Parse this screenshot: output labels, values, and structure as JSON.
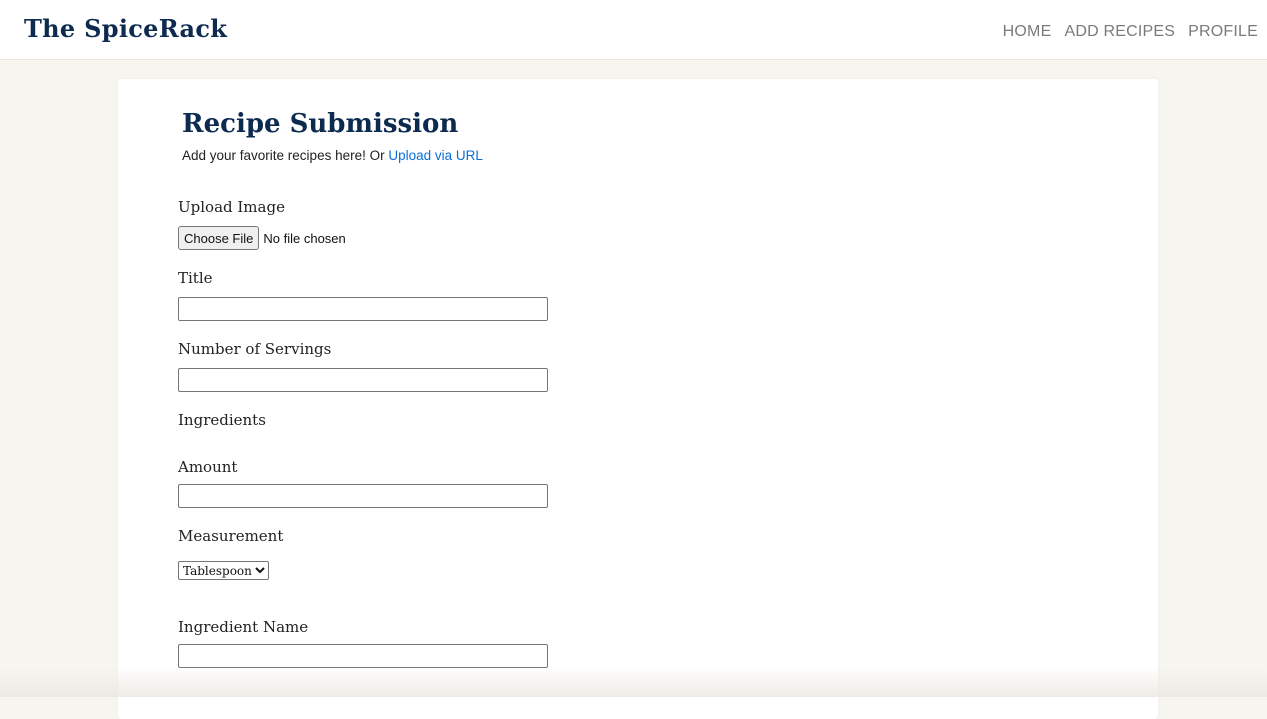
{
  "brand": {
    "logo_text": "The SpiceRack",
    "primary_color": "#0d2a4f",
    "link_color": "#0a6fd8",
    "background_color": "#f7f5f0"
  },
  "nav": {
    "items": [
      {
        "label": "HOME"
      },
      {
        "label": "ADD RECIPES"
      },
      {
        "label": "PROFILE"
      }
    ]
  },
  "form": {
    "title": "Recipe Submission",
    "subtitle_text": "Add your favorite recipes here! Or ",
    "subtitle_link": "Upload via URL",
    "upload_image": {
      "label": "Upload Image",
      "button_label": "Choose File",
      "status": "No file chosen"
    },
    "title_field": {
      "label": "Title",
      "value": ""
    },
    "servings_field": {
      "label": "Number of Servings",
      "value": ""
    },
    "ingredients_heading": "Ingredients",
    "amount_field": {
      "label": "Amount",
      "value": ""
    },
    "measurement_field": {
      "label": "Measurement",
      "selected": "Tablespoon"
    },
    "ingredient_name_field": {
      "label": "Ingredient Name",
      "value": ""
    }
  }
}
